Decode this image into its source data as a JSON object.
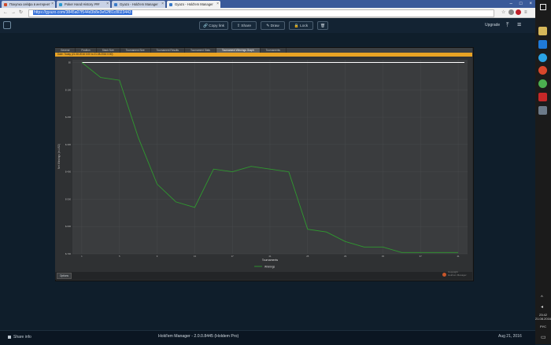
{
  "browser": {
    "tabs": [
      {
        "label": "Покупка сейфа в интернет"
      },
      {
        "label": "Poker Hand History ###"
      },
      {
        "label": "Gyazo - Hold'em Manager"
      },
      {
        "label": "Gyazo - Hold'em Manager"
      }
    ],
    "active_tab": 3,
    "url": "https://gyazo.com/3845a07f544d3b8e3e52f81c8023443"
  },
  "gyazo": {
    "copy_link": "Copy link",
    "share": "Share",
    "draw": "Draw",
    "lock": "Lock",
    "upgrade": "Upgrade",
    "share_info": "Share info",
    "app_title": "Hold'em Manager - 2.0.0.8445 (Holdem Pro)",
    "date": "Aug 21, 2016"
  },
  "hm": {
    "tabs": [
      "General",
      "Position",
      "Stack Size",
      "Tournament Size",
      "Tournament Results",
      "Tournament Stats",
      "Tournament Winnings Graph",
      "Tournaments"
    ],
    "selected_tab": 6,
    "filter": "Date: Today (21.08.2016 0:00 to 21.08.2016 0:00)",
    "options": "Options",
    "brand_line1": "Copyright",
    "brand_line2": "Hold'em Manager"
  },
  "taskbar": {
    "time": "23:42",
    "date": "21.08.2016",
    "lang": "РУС"
  },
  "chart_data": {
    "type": "line",
    "title": "",
    "xlabel": "Tournaments",
    "ylabel": "Net Winnings (in USD)",
    "xlim": [
      0,
      42
    ],
    "ylim": [
      -700,
      10
    ],
    "x_ticks": [
      1,
      5,
      9,
      13,
      17,
      21,
      25,
      29,
      33,
      37,
      41
    ],
    "y_ticks": [
      0,
      -100,
      -200,
      -300,
      -400,
      -500,
      -600,
      -700
    ],
    "y_tick_labels": [
      "$0",
      "$-100",
      "$-200",
      "$-300",
      "$-400",
      "$-500",
      "$-600",
      "$-700"
    ],
    "series": [
      {
        "name": "Winnings",
        "color": "#2f9a2f",
        "x": [
          1,
          3,
          5,
          7,
          9,
          11,
          13,
          15,
          17,
          19,
          21,
          23,
          25,
          27,
          29,
          31,
          33,
          35,
          37,
          39,
          41
        ],
        "y": [
          0,
          -55,
          -65,
          -275,
          -445,
          -510,
          -530,
          -390,
          -400,
          -380,
          -390,
          -400,
          -610,
          -620,
          -655,
          -675,
          -675,
          -695,
          -695,
          -695,
          -695
        ]
      }
    ],
    "zero_line_color": "#ffffff",
    "grid": true,
    "legend": "bottom-center"
  }
}
